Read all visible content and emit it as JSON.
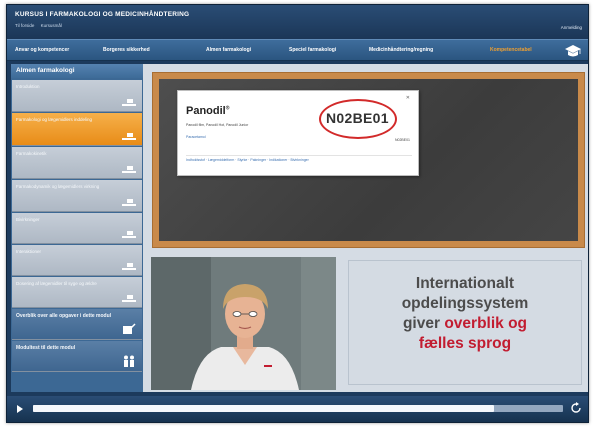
{
  "header": {
    "course_title": "KURSUS I FARMAKOLOGI OG MEDICINHÅNDTERING",
    "links": [
      "Til forside",
      "Kursusmål"
    ],
    "right_link": "Anmelding"
  },
  "nav": {
    "items": [
      {
        "label": "Anvar og kompetencer"
      },
      {
        "label": "Borgeres sikkerhed"
      },
      {
        "label": "Almen farmakologi"
      },
      {
        "label": "Speciel farmakologi"
      },
      {
        "label": "Medicinhåndtering/regning"
      },
      {
        "label": "Kompetencetabel"
      }
    ],
    "active_index": 5,
    "cap_icon": "graduation-cap-icon"
  },
  "sidebar": {
    "title": "Almen farmakologi",
    "items": [
      {
        "label": "Introduktion"
      },
      {
        "label": "Farmakologi og lægemidlers inddeling"
      },
      {
        "label": "Farmakokinetik"
      },
      {
        "label": "Farmakodynamik og lægemidlers virkning"
      },
      {
        "label": "Bivirkninger"
      },
      {
        "label": "Interaktioner"
      },
      {
        "label": "Dosering af lægemidler til syge og ældre"
      },
      {
        "label": "Overblik over alle opgaver i dette modul"
      },
      {
        "label": "Modultest til dette modul"
      }
    ],
    "active_index": 1
  },
  "card": {
    "product": "Panodil",
    "product_mark": "®",
    "description": "Panodil film, Panodil Hot, Panodil Junior",
    "link": "Paracetamol",
    "code": "N02BE01",
    "code_small": "N02BE01",
    "close": "✕",
    "footer": "Indholdsstof · Lægemiddelform · Styrke · Pakninger · Indikationer · Bivirkninger"
  },
  "caption": {
    "line1": "Internationalt",
    "line2": "opdelingssystem",
    "line3_a": "giver ",
    "line3_b": "overblik og",
    "line4": "fælles sprog"
  },
  "player": {
    "progress": 0.87,
    "play_icon": "play-icon",
    "replay_icon": "replay-icon"
  },
  "colors": {
    "accent_orange": "#e88c18",
    "header_blue": "#1c3a5c",
    "highlight_red": "#c21c30",
    "circle_red": "#d22a2a"
  }
}
